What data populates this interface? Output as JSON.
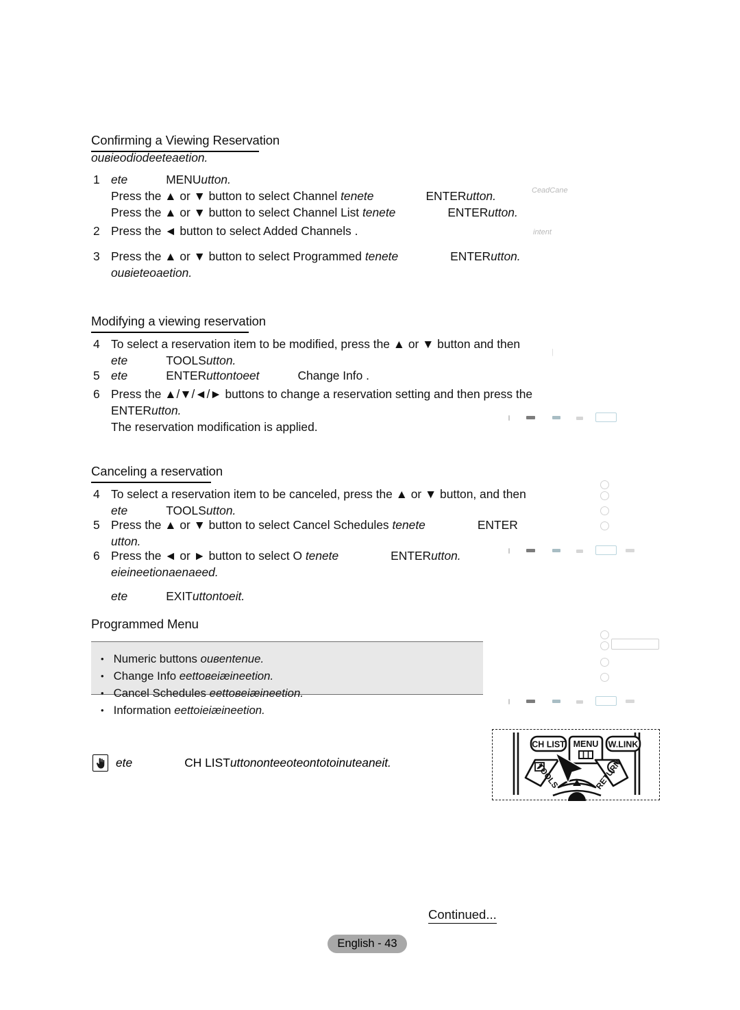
{
  "document": {
    "page_label": "English - 43",
    "continued_label": "Continued..."
  },
  "sections": [
    {
      "id": "confirming",
      "heading": "Confirming a Viewing Reservation",
      "intro": "ouʙieodiodeeteaetion.",
      "steps": [
        {
          "number": "1",
          "lines": [
            {
              "pre_italic": "ete",
              "key": "MENU",
              "post_italic": "utton."
            },
            {
              "text": "Press the ▲ or ▼ button to select Channel ",
              "italic_tail": "tenete",
              "key": "ENTER",
              "post_italic": "utton."
            },
            {
              "text": "Press the ▲ or ▼ button to select Channel List ",
              "italic_tail": "tenete",
              "key": "ENTER",
              "post_italic": "utton."
            }
          ]
        },
        {
          "number": "2",
          "lines": [
            {
              "text": "Press the ◄ button to select Added Channels  ."
            }
          ]
        },
        {
          "number": "3",
          "lines": [
            {
              "text": "Press the ▲ or ▼ button to select Programmed ",
              "italic_tail": "tenete",
              "key": "ENTER",
              "post_italic": "utton."
            },
            {
              "italic_only": "ouʙieteoaetion."
            }
          ]
        }
      ]
    },
    {
      "id": "modifying",
      "heading": "Modifying a viewing reservation",
      "steps": [
        {
          "number": "4",
          "lines": [
            {
              "text": "To select a reservation item to be modified, press the ▲ or ▼ button and then"
            },
            {
              "pre_italic": "ete",
              "key": "TOOLS",
              "post_italic": "utton."
            }
          ]
        },
        {
          "number": "5",
          "lines": [
            {
              "pre_italic": "ete",
              "key": "ENTER",
              "post_italic": "uttontoeet",
              "tail": "Change Info ."
            }
          ]
        },
        {
          "number": "6",
          "lines": [
            {
              "text": "Press the ▲/▼/◄/► buttons to change a reservation setting and then press the"
            },
            {
              "key": "ENTER",
              "post_italic": "utton."
            },
            {
              "text": "The reservation modification is applied."
            }
          ]
        }
      ]
    },
    {
      "id": "canceling",
      "heading": "Canceling a reservation",
      "steps": [
        {
          "number": "4",
          "lines": [
            {
              "text": "To select a reservation item to be canceled, press the ▲ or ▼ button, and then"
            },
            {
              "pre_italic": "ete",
              "key": "TOOLS",
              "post_italic": "utton."
            }
          ]
        },
        {
          "number": "5",
          "lines": [
            {
              "text": "Press the ▲ or ▼ button to select Cancel Schedules ",
              "italic_tail": "tenete",
              "key": "ENTER"
            },
            {
              "italic_only": "utton."
            }
          ]
        },
        {
          "number": "6",
          "lines": [
            {
              "text": "Press the ◄ or ► button to select O  ",
              "italic_tail": "tenete",
              "key": "ENTER",
              "post_italic": "utton."
            },
            {
              "italic_only": "eieineetionaenaeed."
            },
            {
              "pre_italic": "ete",
              "key": "EXIT",
              "post_italic": "uttontoeit."
            }
          ]
        }
      ]
    }
  ],
  "programmed_menu": {
    "heading": "Programmed Menu",
    "items": [
      {
        "label": "Numeric buttons",
        "desc": "ouʙentenue."
      },
      {
        "label": "Change Info",
        "desc": "eettoʙeiæineetion."
      },
      {
        "label": "Cancel Schedules",
        "desc": "eettoʙeiæineetion."
      },
      {
        "label": "Information",
        "desc": "eettoieiæineetion."
      }
    ]
  },
  "note": {
    "icon": "pointing-hand-icon",
    "prefix": "ete",
    "key": "CH LIST",
    "text": "uttononteeoteontotoinuteaneit."
  },
  "remote": {
    "buttons": {
      "ch_list": "CH LIST",
      "menu": "MENU",
      "w_link": "W.LINK",
      "tools": "TOOLS",
      "return": "RETURN"
    }
  },
  "ghost_text": {
    "top": "CeadCane",
    "second": "intent"
  }
}
